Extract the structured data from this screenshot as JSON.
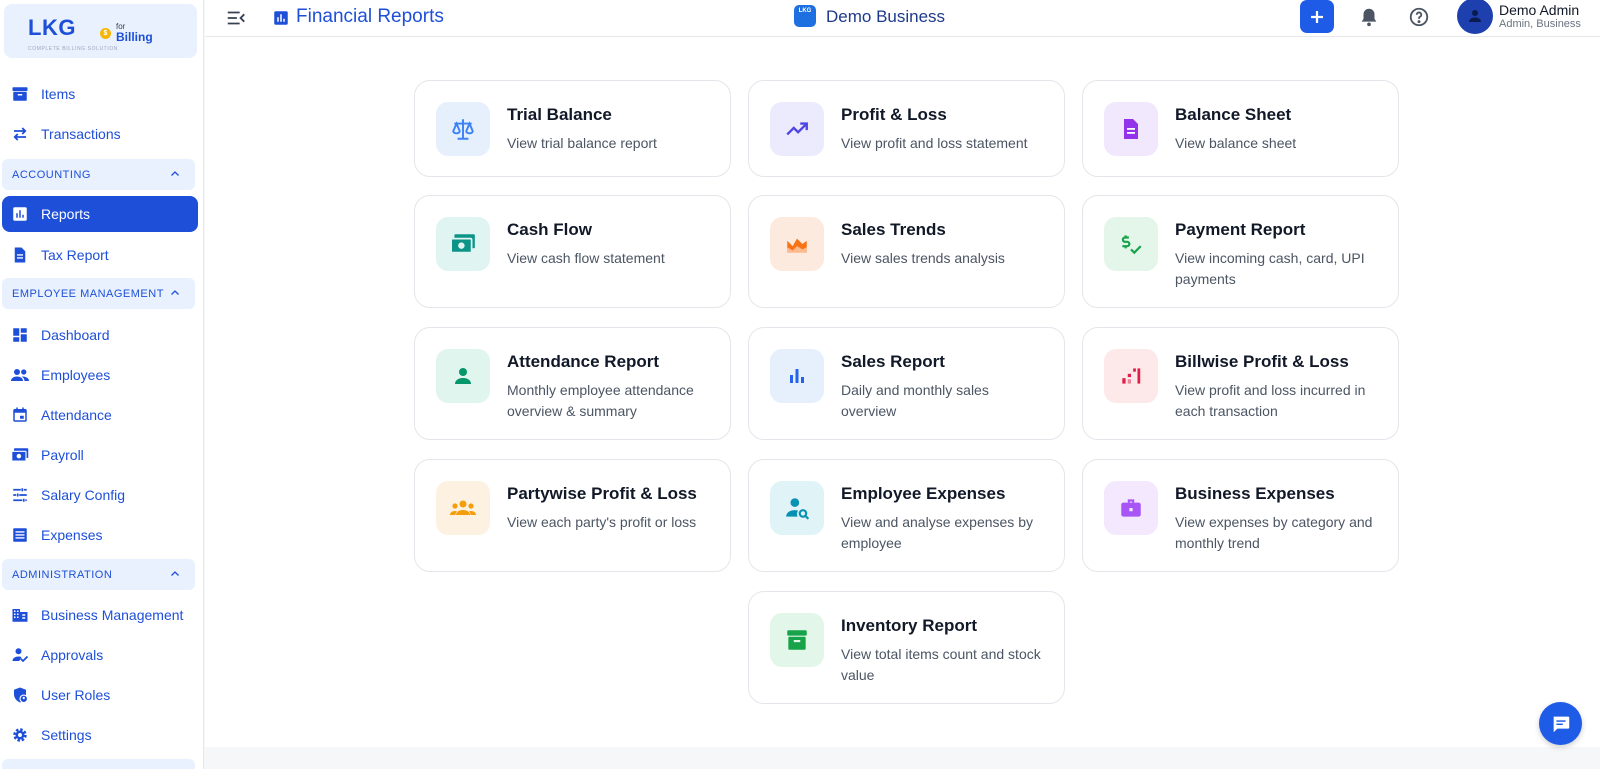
{
  "brand": {
    "logo_text": "LKG",
    "for_text": "for",
    "billing_text": "Billing",
    "tagline": "COMPLETE BILLING SOLUTION"
  },
  "sidebar": {
    "items": [
      {
        "label": "Items",
        "icon": "archive-icon"
      },
      {
        "label": "Transactions",
        "icon": "swap-arrows-icon"
      },
      {
        "label": "Reports",
        "icon": "bar-chart-icon",
        "active": true
      },
      {
        "label": "Tax Report",
        "icon": "document-icon"
      },
      {
        "label": "Dashboard",
        "icon": "dashboard-icon"
      },
      {
        "label": "Employees",
        "icon": "people-icon"
      },
      {
        "label": "Attendance",
        "icon": "calendar-icon"
      },
      {
        "label": "Payroll",
        "icon": "money-icon"
      },
      {
        "label": "Salary Config",
        "icon": "sliders-icon"
      },
      {
        "label": "Expenses",
        "icon": "list-icon"
      },
      {
        "label": "Business Management",
        "icon": "building-icon"
      },
      {
        "label": "Approvals",
        "icon": "person-check-icon"
      },
      {
        "label": "User Roles",
        "icon": "shield-person-icon"
      },
      {
        "label": "Settings",
        "icon": "gear-icon"
      }
    ],
    "sections": [
      {
        "label": "ACCOUNTING"
      },
      {
        "label": "EMPLOYEE MANAGEMENT"
      },
      {
        "label": "ADMINISTRATION"
      }
    ]
  },
  "header": {
    "title": "Financial Reports",
    "business_logo": "LKG",
    "business_name": "Demo Business",
    "user_name": "Demo Admin",
    "user_role": "Admin, Business"
  },
  "cards": [
    {
      "title": "Trial Balance",
      "desc": "View trial balance report",
      "icon": "scale-icon",
      "bg": "#e6f0fd",
      "fg": "#3b82f6"
    },
    {
      "title": "Profit & Loss",
      "desc": "View profit and loss statement",
      "icon": "trending-up-icon",
      "bg": "#ecebfd",
      "fg": "#4f46e5"
    },
    {
      "title": "Balance Sheet",
      "desc": "View balance sheet",
      "icon": "document-icon",
      "bg": "#f1e8fd",
      "fg": "#9333ea"
    },
    {
      "title": "Cash Flow",
      "desc": "View cash flow statement",
      "icon": "cash-icon",
      "bg": "#e0f5f1",
      "fg": "#0d9488"
    },
    {
      "title": "Sales Trends",
      "desc": "View sales trends analysis",
      "icon": "area-chart-icon",
      "bg": "#fdeadf",
      "fg": "#f97316"
    },
    {
      "title": "Payment Report",
      "desc": "View incoming cash, card, UPI payments",
      "icon": "price-check-icon",
      "bg": "#e4f5ea",
      "fg": "#16a34a"
    },
    {
      "title": "Attendance Report",
      "desc": "Monthly employee attendance overview & summary",
      "icon": "person-icon",
      "bg": "#e0f5ee",
      "fg": "#059669"
    },
    {
      "title": "Sales Report",
      "desc": "Daily and monthly sales overview",
      "icon": "bar-chart-icon",
      "bg": "#e6f0fd",
      "fg": "#2563eb"
    },
    {
      "title": "Billwise Profit & Loss",
      "desc": "View profit and loss incurred in each transaction",
      "icon": "stairs-chart-icon",
      "bg": "#fde8ea",
      "fg": "#e11d48"
    },
    {
      "title": "Partywise Profit & Loss",
      "desc": "View each party's profit or loss",
      "icon": "groups-icon",
      "bg": "#fdf1e2",
      "fg": "#f59e0b"
    },
    {
      "title": "Employee Expenses",
      "desc": "View and analyse expenses by employee",
      "icon": "person-search-icon",
      "bg": "#e0f4f8",
      "fg": "#0891b2"
    },
    {
      "title": "Business Expenses",
      "desc": "View expenses by category and monthly trend",
      "icon": "briefcase-icon",
      "bg": "#f3e8fd",
      "fg": "#a855f7"
    },
    {
      "title": "Inventory Report",
      "desc": "View total items count and stock value",
      "icon": "inventory-box-icon",
      "bg": "#e2f6e9",
      "fg": "#16a34a"
    }
  ]
}
